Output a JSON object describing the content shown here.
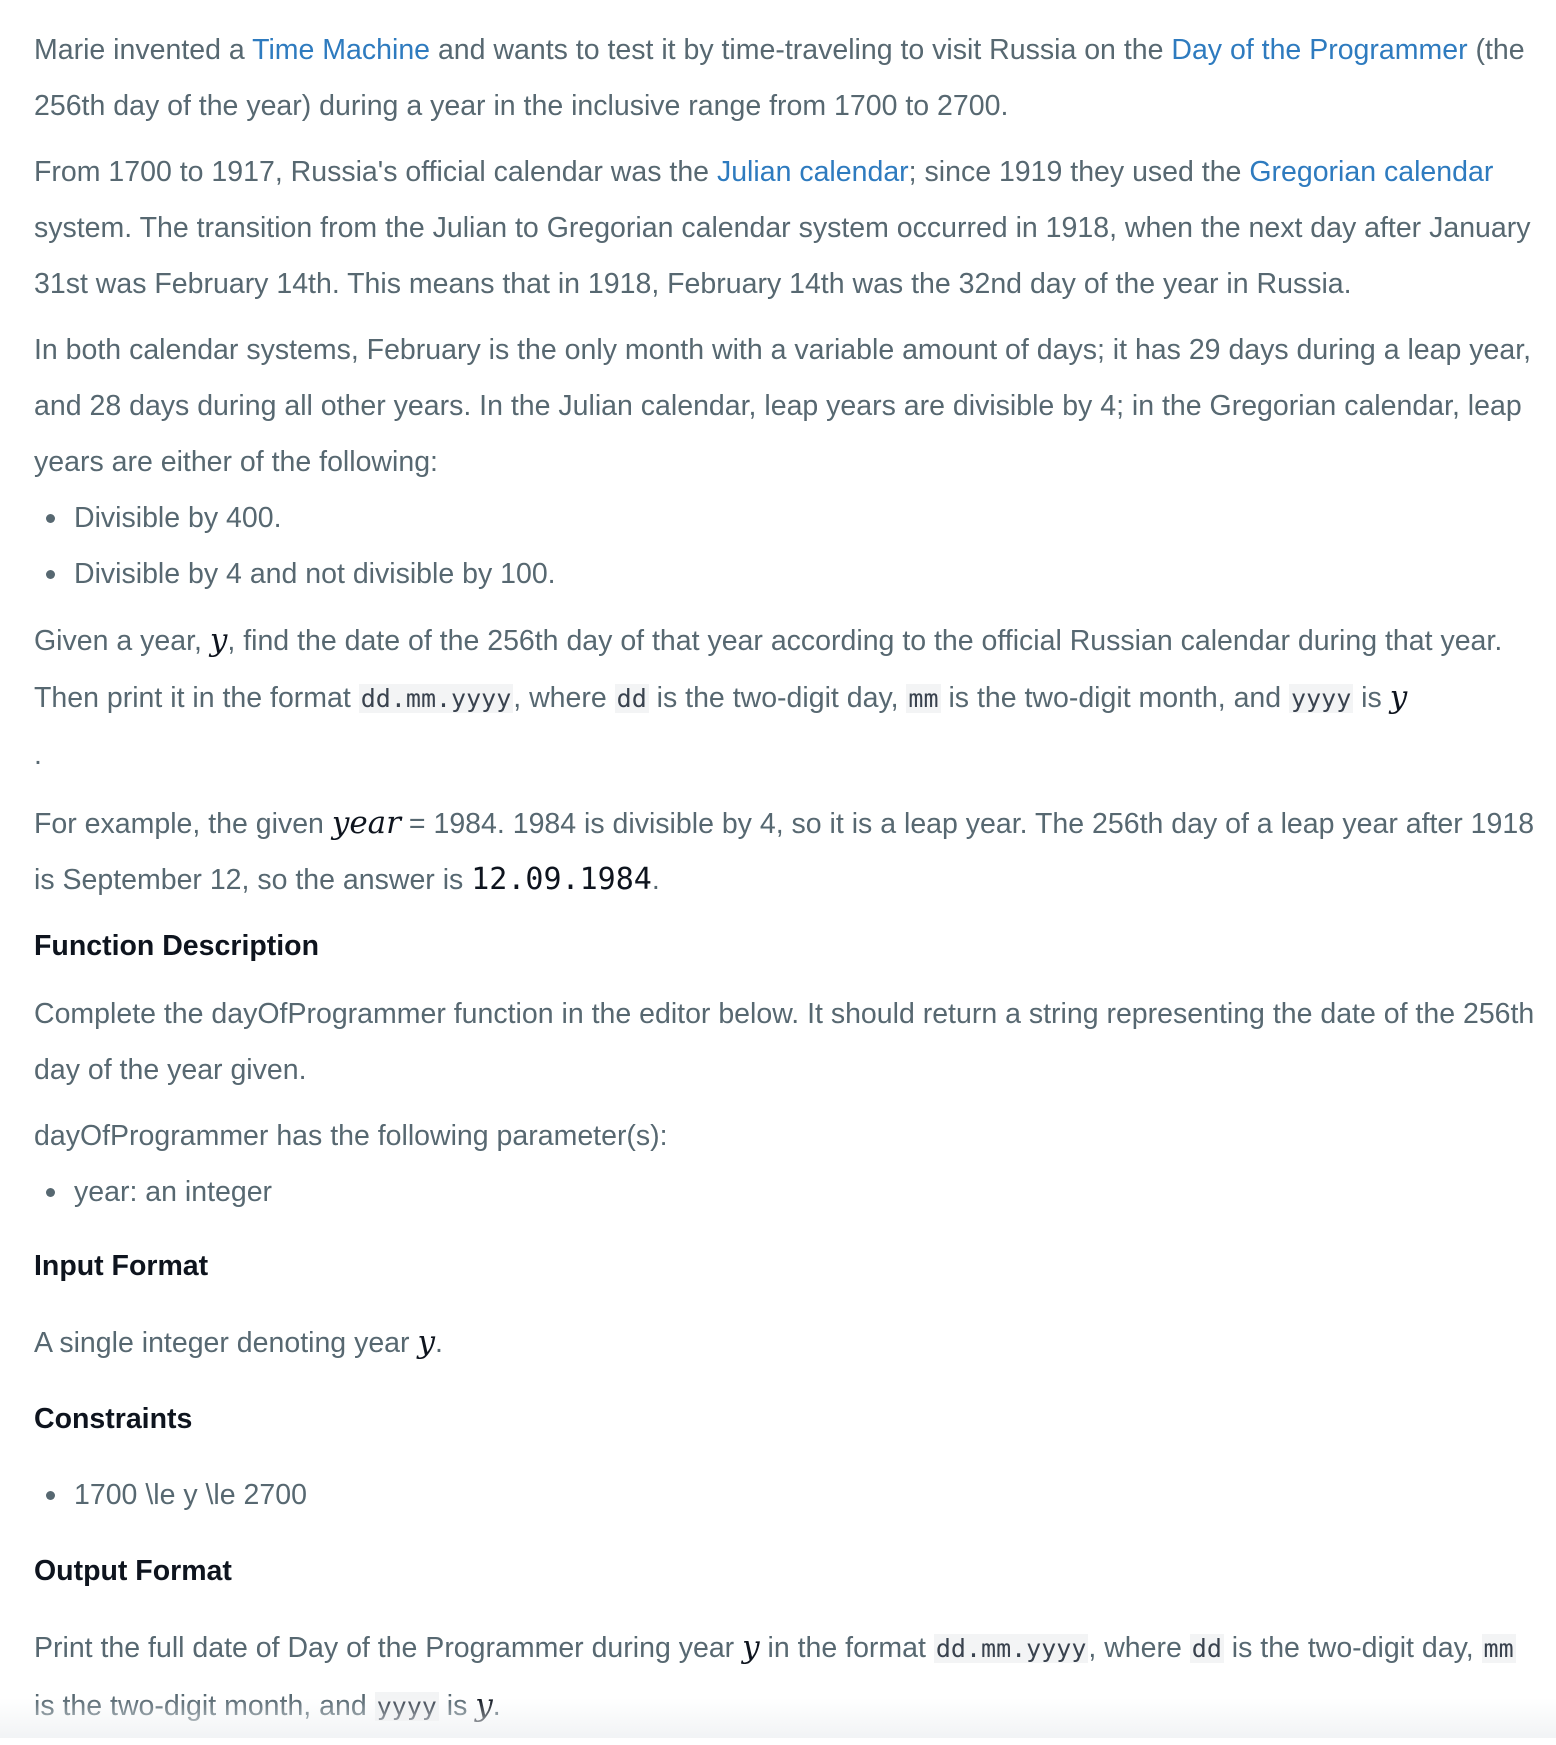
{
  "intro": {
    "t1": "Marie invented a ",
    "link_time_machine": "Time Machine",
    "t2": " and wants to test it by time-traveling to visit Russia on the ",
    "link_dotp": "Day of the Programmer",
    "t3": " (the 256th day of the year) during a year in the inclusive range from 1700 to 2700."
  },
  "calendar": {
    "t1": "From 1700 to 1917, Russia's official calendar was the ",
    "link_julian": "Julian calendar",
    "t2": "; since 1919 they used the ",
    "link_gregorian": "Gregorian calendar",
    "t3": " system. The transition from the Julian to Gregorian calendar system occurred in 1918, when the next day after January 31st was February 14th. This means that in 1918, February 14th was the 32nd day of the year in Russia."
  },
  "leap": {
    "text": "In both calendar systems, February is the only month with a variable amount of days; it has 29 days during a leap year, and 28 days during all other years. In the Julian calendar, leap years are divisible by 4; in the Gregorian calendar, leap years are either of the following:",
    "rules": [
      "Divisible by 400.",
      "Divisible by 4 and not divisible by 100."
    ]
  },
  "task": {
    "t1": "Given a year, ",
    "var_y": "y",
    "t2": ", find the date of the 256th day of that year according to the official Russian calendar during that year. Then print it in the format ",
    "code_format": "dd.mm.yyyy",
    "t3": ", where ",
    "code_dd": "dd",
    "t4": " is the two-digit day, ",
    "code_mm": "mm",
    "t5": " is the two-digit month, and ",
    "code_yyyy": "yyyy",
    "t6": " is ",
    "var_y2": "y",
    "trailing_dot": "."
  },
  "example": {
    "t1": "For example, the given ",
    "var_year": "year",
    "t2": " = 1984. 1984 is divisible by 4, so it is a leap year. The 256th day of a leap year after 1918 is September 12, so the answer is ",
    "answer": "12.09.1984",
    "t3": "."
  },
  "function_description": {
    "heading": "Function Description",
    "text": "Complete the dayOfProgrammer function in the editor below. It should return a string representing the date of the 256th day of the year given.",
    "params_intro": "dayOfProgrammer has the following parameter(s):",
    "params": [
      "year: an integer"
    ]
  },
  "input_format": {
    "heading": "Input Format",
    "t1": "A single integer denoting year ",
    "var_y": "y",
    "t2": "."
  },
  "constraints": {
    "heading": "Constraints",
    "items": [
      "1700 \\le y \\le 2700"
    ]
  },
  "output_format": {
    "heading": "Output Format",
    "t1": "Print the full date of Day of the Programmer during year ",
    "var_y": "y",
    "t2": " in the format ",
    "code_format": "dd.mm.yyyy",
    "t3": ", where ",
    "code_dd": "dd",
    "t4": " is the two-digit day, ",
    "code_mm": "mm",
    "t5": " is the two-digit month, and ",
    "code_yyyy": "yyyy",
    "t6": " is ",
    "var_y2": "y",
    "t7": "."
  }
}
